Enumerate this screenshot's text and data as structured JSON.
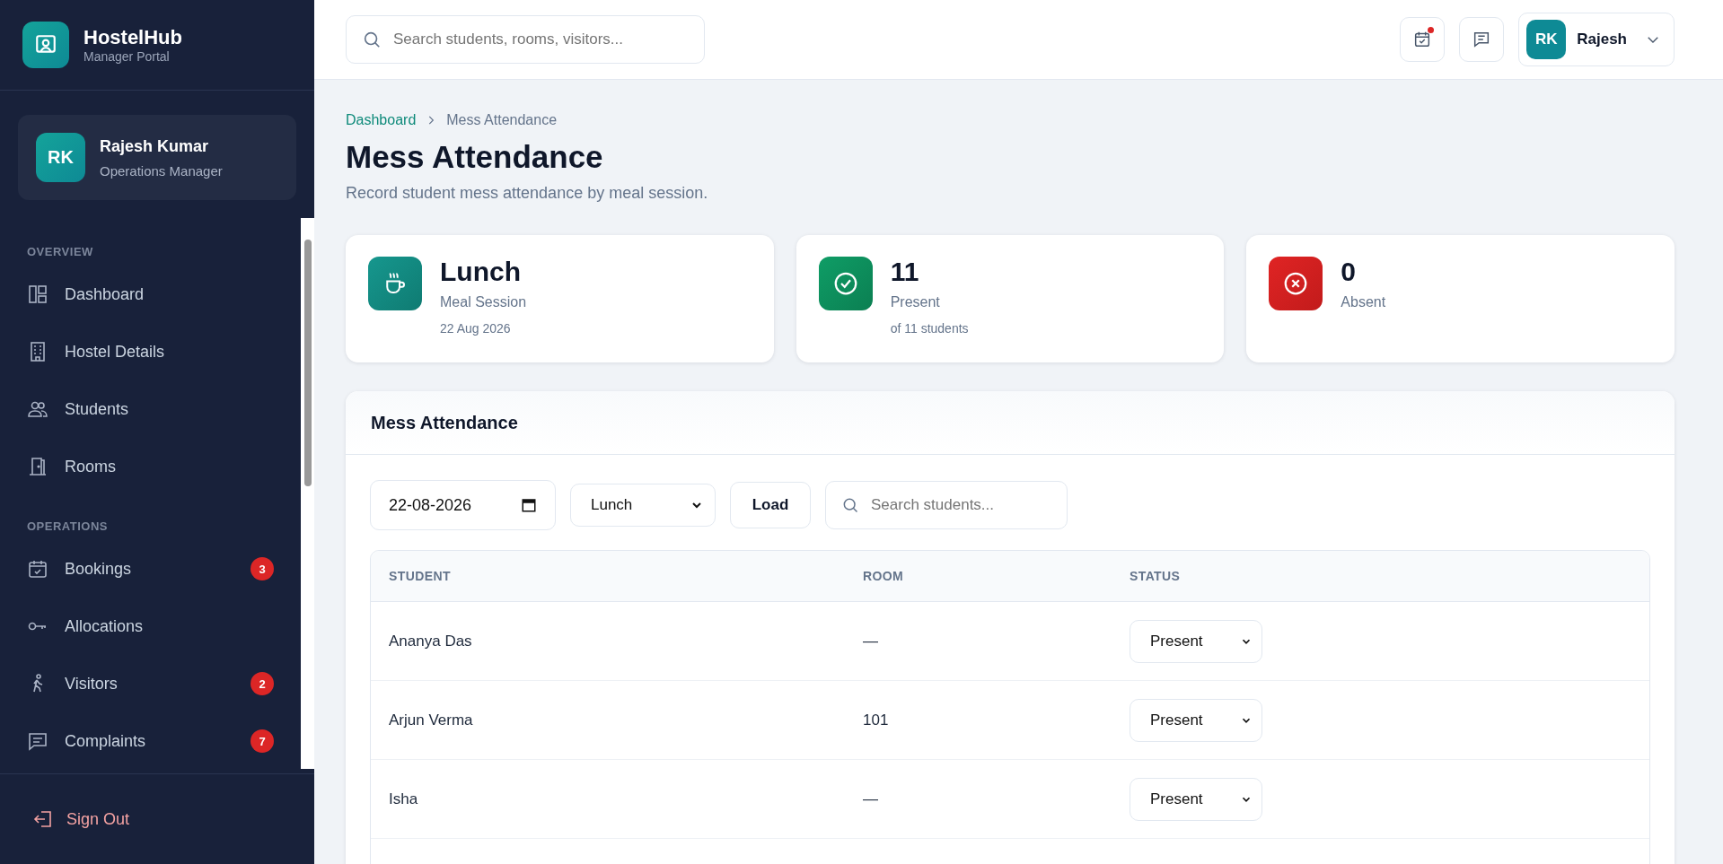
{
  "brand": {
    "name": "HostelHub",
    "subtitle": "Manager Portal"
  },
  "profile": {
    "initials": "RK",
    "name": "Rajesh Kumar",
    "role": "Operations Manager"
  },
  "nav_sections": [
    {
      "title": "OVERVIEW",
      "items": [
        {
          "label": "Dashboard",
          "selected": false
        },
        {
          "label": "Hostel Details",
          "selected": false
        },
        {
          "label": "Students",
          "selected": false
        },
        {
          "label": "Rooms",
          "selected": false
        }
      ]
    },
    {
      "title": "OPERATIONS",
      "items": [
        {
          "label": "Bookings",
          "selected": false,
          "badge": "3"
        },
        {
          "label": "Allocations",
          "selected": false
        },
        {
          "label": "Visitors",
          "selected": false,
          "badge": "2"
        },
        {
          "label": "Complaints",
          "selected": false,
          "badge": "7"
        }
      ]
    }
  ],
  "sign_out": "Sign Out",
  "topbar": {
    "search_placeholder": "Search students, rooms, visitors...",
    "calendar_has_notification": true,
    "user": {
      "initials": "RK",
      "name": "Rajesh"
    }
  },
  "breadcrumb": [
    {
      "label": "Dashboard",
      "kind": "link"
    },
    {
      "label": "Mess Attendance",
      "kind": "current"
    }
  ],
  "page_title": "Mess Attendance",
  "page_subtitle": "Record student mess attendance by meal session.",
  "stats": [
    {
      "kind": "session",
      "value": "Lunch",
      "label": "Meal Session",
      "note": "22 Aug 2026"
    },
    {
      "kind": "present",
      "value": "11",
      "label": "Present",
      "note": "of 11 students"
    },
    {
      "kind": "absent",
      "value": "0",
      "label": "Absent"
    }
  ],
  "attendance": {
    "title": "Mess Attendance",
    "date": "22-08-2026",
    "session": "Lunch",
    "load_button": "Load",
    "search_placeholder": "Search students...",
    "columns": [
      "STUDENT",
      "ROOM",
      "STATUS"
    ],
    "rows": [
      {
        "student": "Ananya Das",
        "room": "—",
        "status": "Present"
      },
      {
        "student": "Arjun Verma",
        "room": "101",
        "status": "Present"
      },
      {
        "student": "Isha",
        "room": "—",
        "status": "Present"
      }
    ]
  }
}
